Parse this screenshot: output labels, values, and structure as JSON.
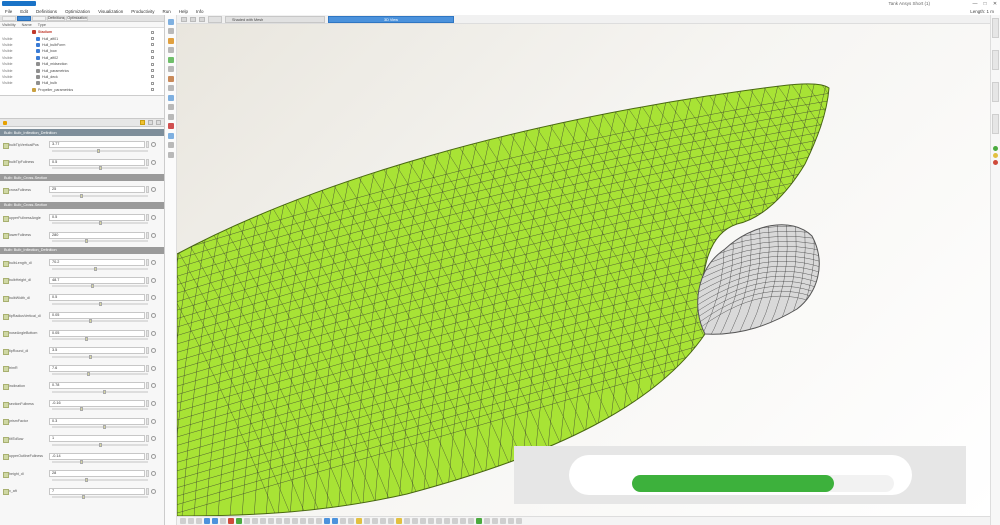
{
  "app": {
    "window_title": "Tank Ansys Short (1)",
    "window_controls": [
      "—",
      "□",
      "✕"
    ]
  },
  "menu": {
    "items": [
      "File",
      "Edit",
      "Definitions",
      "Optimization",
      "Visualization",
      "Productivity",
      "Run",
      "Help",
      "Info"
    ],
    "right_info": "Length: 1 m"
  },
  "left_toolbar": {
    "buttons": [
      "",
      "",
      "",
      "Definitions",
      "Optimization"
    ]
  },
  "tree": {
    "headers": [
      "Visibility",
      "Name",
      "Type"
    ],
    "rows": [
      {
        "col": "",
        "name": "Stadium",
        "indent": 2,
        "color": "#c0392b",
        "red": true
      },
      {
        "col": "Visible",
        "name": "Hull_aft01",
        "indent": 3,
        "color": "#3a7bd5"
      },
      {
        "col": "Visible",
        "name": "Hull_bulbForm",
        "indent": 3,
        "color": "#3a7bd5"
      },
      {
        "col": "Visible",
        "name": "Hull_bow",
        "indent": 3,
        "color": "#3a7bd5"
      },
      {
        "col": "Visible",
        "name": "Hull_aft02",
        "indent": 3,
        "color": "#3a7bd5"
      },
      {
        "col": "Visible",
        "name": "Hull_midsection",
        "indent": 3,
        "color": "#8f8f8f"
      },
      {
        "col": "Visible",
        "name": "Hull_parametrics",
        "indent": 3,
        "color": "#8f8f8f"
      },
      {
        "col": "Visible",
        "name": "Hull_deck",
        "indent": 3,
        "color": "#8f8f8f"
      },
      {
        "col": "Visible",
        "name": "Hull_bulb",
        "indent": 3,
        "color": "#8f8f8f"
      },
      {
        "col": "",
        "name": "Propeller_parametrics",
        "indent": 2,
        "color": "#c9a040"
      }
    ]
  },
  "params": {
    "sections": [
      {
        "title": "Bulb: Bulb_Inflection_Definition",
        "rows": [
          {
            "label": "bulbTipVerticalPos",
            "value": "3.77",
            "slider": 0.48
          },
          {
            "label": "bulbTipFullness",
            "value": "0.5",
            "slider": 0.5
          }
        ]
      },
      {
        "title": "Bulb: Bulb_Cross-Section",
        "rows": [
          {
            "label": "crossFullness",
            "value": "25",
            "slider": 0.3
          }
        ]
      },
      {
        "title": "Bulb: Bulb_Cross-Section",
        "rows": [
          {
            "label": "upperFullnessAngle",
            "value": "0.5",
            "slider": 0.5
          },
          {
            "label": "lowerFullness",
            "value": "280",
            "slider": 0.35
          }
        ]
      },
      {
        "title": "Bulb: Bulb_Inflection_Definition",
        "rows": [
          {
            "label": "bulbLength_dl",
            "value": "70.2",
            "slider": 0.45
          },
          {
            "label": "bulbHeight_dl",
            "value": "48.7",
            "slider": 0.42
          },
          {
            "label": "bulbWidth_dl",
            "value": "0.5",
            "slider": 0.5
          },
          {
            "label": "tipRadiusVertical_dl",
            "value": "0.05",
            "slider": 0.4
          },
          {
            "label": "noseAngleBottom",
            "value": "0.05",
            "slider": 0.35
          },
          {
            "label": "tipRound_dl",
            "value": "3.5",
            "slider": 0.4
          },
          {
            "label": "trimR",
            "value": "7.6",
            "slider": 0.38
          },
          {
            "label": "inclination",
            "value": "0.78",
            "slider": 0.55
          },
          {
            "label": "sectionFullness",
            "value": "-0.16",
            "slider": 0.3
          },
          {
            "label": "prismFactor",
            "value": "0.3",
            "slider": 0.55
          },
          {
            "label": "tiltToBow",
            "value": "1",
            "slider": 0.5
          },
          {
            "label": "upperOutlineFullness",
            "value": "-0.14",
            "slider": 0.3
          },
          {
            "label": "height_dl",
            "value": "28",
            "slider": 0.36
          },
          {
            "label": "x_aft",
            "value": "7",
            "slider": 0.32
          }
        ]
      }
    ]
  },
  "viewport": {
    "tabs": [
      "",
      "Shaded with Mesh",
      "3D View"
    ],
    "hull_color": "#a8e335",
    "bulb_color": "#d9d9d9",
    "mesh_color": "#333333"
  },
  "progress": {
    "value": 0.77,
    "color": "#3db13c"
  },
  "colors": {
    "accent": "#4b92dc",
    "status_green": "#4aaa3e",
    "status_yellow": "#e2c040",
    "status_red": "#cf4a3a"
  }
}
